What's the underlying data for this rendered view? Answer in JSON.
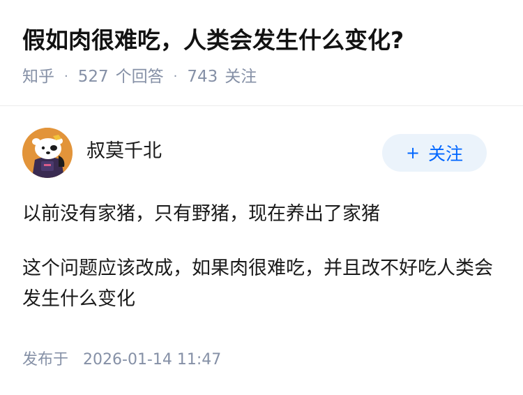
{
  "question": {
    "title": "假如肉很难吃，人类会发生什么变化?",
    "source": "知乎",
    "answer_count": "527",
    "answer_label": "个回答",
    "follower_count": "743",
    "follower_label": "关注"
  },
  "answer": {
    "author_name": "叔莫千北",
    "follow_button": {
      "icon": "+",
      "label": "关注"
    },
    "paragraphs": [
      "以前没有家猪，只有野猪，现在养出了家猪",
      "这个问题应该改成，如果肉很难吃，并且改不好吃人类会发生什么变化"
    ],
    "publish_label": "发布于",
    "publish_time": "2026-01-14 11:47"
  },
  "colors": {
    "accent": "#0066ff",
    "follow_bg": "#ebf3fb",
    "meta_text": "#8590a6",
    "avatar_bg": "#e2943a"
  }
}
